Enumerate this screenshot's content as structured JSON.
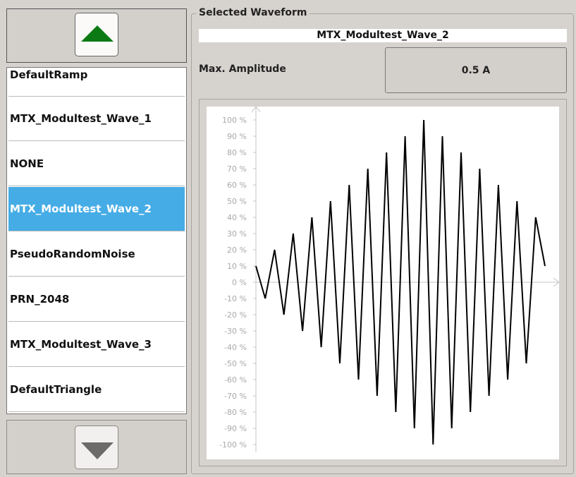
{
  "list": {
    "items": [
      {
        "label": "DefaultRamp",
        "selected": false
      },
      {
        "label": "MTX_Modultest_Wave_1",
        "selected": false
      },
      {
        "label": "NONE",
        "selected": false
      },
      {
        "label": "MTX_Modultest_Wave_2",
        "selected": true
      },
      {
        "label": "PseudoRandomNoise",
        "selected": false
      },
      {
        "label": "PRN_2048",
        "selected": false
      },
      {
        "label": "MTX_Modultest_Wave_3",
        "selected": false
      },
      {
        "label": "DefaultTriangle",
        "selected": false
      }
    ],
    "scroll_up_icon": "triangle-up-icon",
    "scroll_down_icon": "triangle-down-icon",
    "up_icon_color": "#0b7a14",
    "down_icon_color": "#6d6b69",
    "selected_color": "#45ace6"
  },
  "panel": {
    "group_title": "Selected Waveform",
    "waveform_name": "MTX_Modultest_Wave_2",
    "amplitude_label": "Max. Amplitude",
    "amplitude_value": "0.5 A"
  },
  "chart_data": {
    "type": "line",
    "title": "",
    "xlabel": "",
    "ylabel": "",
    "ylim": [
      -100,
      100
    ],
    "y_ticks": [
      "100 %",
      "90 %",
      "80 %",
      "70 %",
      "60 %",
      "50 %",
      "40 %",
      "30 %",
      "20 %",
      "10 %",
      "0 %",
      "-10 %",
      "-20 %",
      "-30 %",
      "-40 %",
      "-50 %",
      "-60 %",
      "-70 %",
      "-80 %",
      "-90 %",
      "-100 %"
    ],
    "grid": false,
    "series": [
      {
        "values": [
          10,
          -10,
          20,
          -20,
          30,
          -30,
          40,
          -40,
          50,
          -50,
          60,
          -60,
          70,
          -70,
          80,
          -80,
          90,
          -90,
          100,
          -100,
          90,
          -90,
          80,
          -80,
          70,
          -70,
          60,
          -60,
          50,
          -50,
          40,
          10
        ],
        "color": "#000000"
      }
    ]
  }
}
